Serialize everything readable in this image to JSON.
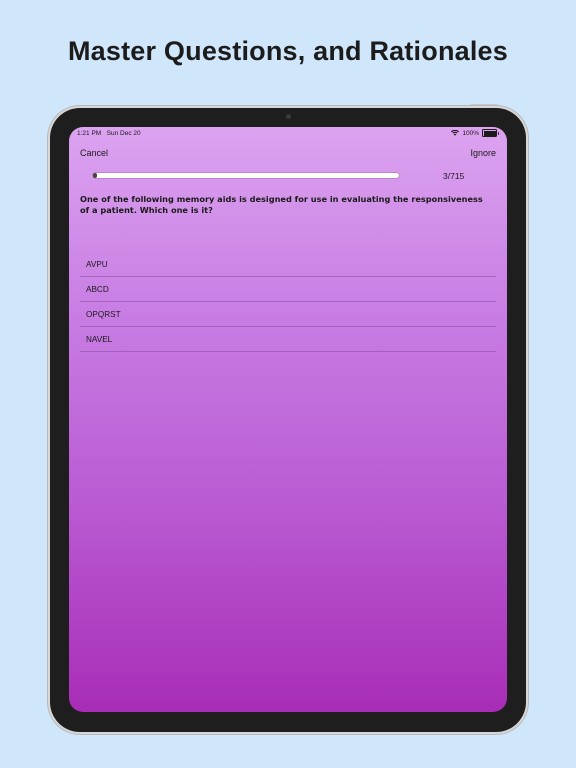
{
  "headline": "Master Questions, and Rationales",
  "status_bar": {
    "time": "1:21 PM",
    "date": "Sun Dec 20",
    "battery_text": "100%",
    "wifi_icon": "wifi-icon",
    "battery_icon": "battery-icon",
    "battery_level": 1.0
  },
  "nav": {
    "cancel_label": "Cancel",
    "ignore_label": "Ignore"
  },
  "progress": {
    "count_text": "3/715",
    "current": 3,
    "total": 715
  },
  "question": {
    "text": "One of the following memory aids is designed for use in evaluating the responsiveness of a patient. Which one is it?"
  },
  "answers": [
    {
      "label": "AVPU"
    },
    {
      "label": "ABCD"
    },
    {
      "label": "OPQRST"
    },
    {
      "label": "NAVEL"
    }
  ],
  "colors": {
    "page_background": "#cfe6fb",
    "gradient_top": "#dca3f0",
    "gradient_bottom": "#a82db7",
    "device_frame": "#1e1e1e"
  }
}
